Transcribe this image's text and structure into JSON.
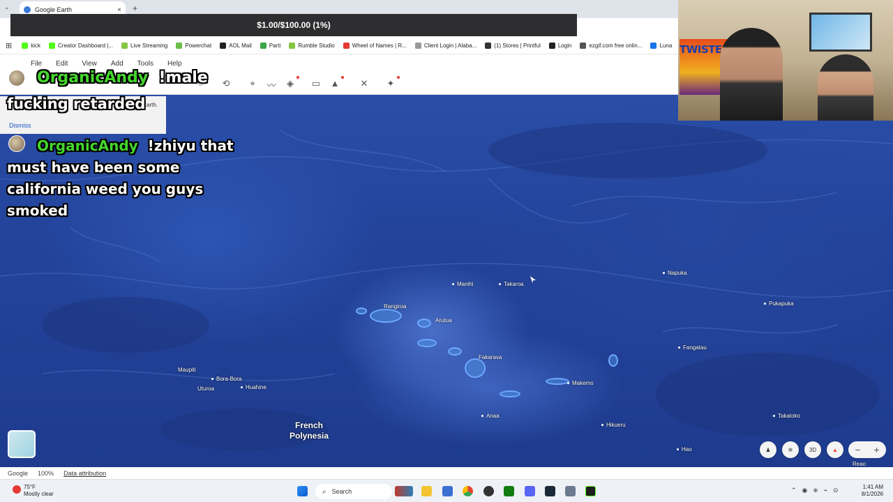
{
  "browser": {
    "tab_title": "Google Earth",
    "new_tab": "+",
    "close": "×",
    "tab_menu": "⌄"
  },
  "donation": {
    "text": "$1.00/$100.00 (1%)"
  },
  "bookmarks": {
    "apps_icon": "⊞",
    "items": [
      {
        "label": "kick",
        "color": "#53fc18"
      },
      {
        "label": "Creator Dashboard |...",
        "color": "#53fc18"
      },
      {
        "label": "Live Streaming",
        "color": "#85c742"
      },
      {
        "label": "Powerchat",
        "color": "#6cc04a"
      },
      {
        "label": "AOL Mail",
        "color": "#222222"
      },
      {
        "label": "Parti",
        "color": "#3ba54a"
      },
      {
        "label": "Rumble Studio",
        "color": "#85c742"
      },
      {
        "label": "Wheel of Names | R...",
        "color": "#e53935"
      },
      {
        "label": "Client Login | Alaba...",
        "color": "#999999"
      },
      {
        "label": "(1) Stores | Printful",
        "color": "#333333"
      },
      {
        "label": "Login",
        "color": "#222222"
      },
      {
        "label": "ezgif.com free onlin...",
        "color": "#555555"
      },
      {
        "label": "Luna",
        "color": "#1a73e8"
      }
    ]
  },
  "menubar": {
    "items": [
      "File",
      "Edit",
      "View",
      "Add",
      "Tools",
      "Help"
    ]
  },
  "notice": {
    "text": "e Earth.",
    "dismiss": "Dismiss"
  },
  "chat": [
    {
      "name": "OrganicAndy",
      "text_inline": "!male",
      "text": "fucking retarded"
    },
    {
      "name": "OrganicAndy",
      "text": "!zhiyu that must have been some california weed you guys smoked"
    }
  ],
  "map": {
    "places": [
      "Manihi",
      "Takaroa",
      "Napuka",
      "Rangiroa",
      "Arutua",
      "Pukapuka",
      "Fakarava",
      "Fangatau",
      "Makemo",
      "Maupiti",
      "Bora-Bora",
      "Uturoa",
      "Huahine",
      "Anaa",
      "Hikueru",
      "Takatoko",
      "Hao",
      "Reao"
    ],
    "region": [
      "French",
      "Polynesia"
    ]
  },
  "webcam": {
    "flag_text": "TWISTED TEA"
  },
  "earthbar": {
    "brand": "Google",
    "zoom": "100%",
    "attribution": "Data attribution"
  },
  "map_controls": {
    "three_d": "3D",
    "zoom_out": "−",
    "zoom_in": "+"
  },
  "taskbar": {
    "temp": "75°F",
    "condition": "Mostly clear",
    "search": "Search",
    "time": "1:41 AM",
    "date": "8/1/2026"
  },
  "colors": {
    "chat_name": "#44d62c",
    "ocean": "#23439a",
    "donation_bar": "#2e2e30"
  }
}
